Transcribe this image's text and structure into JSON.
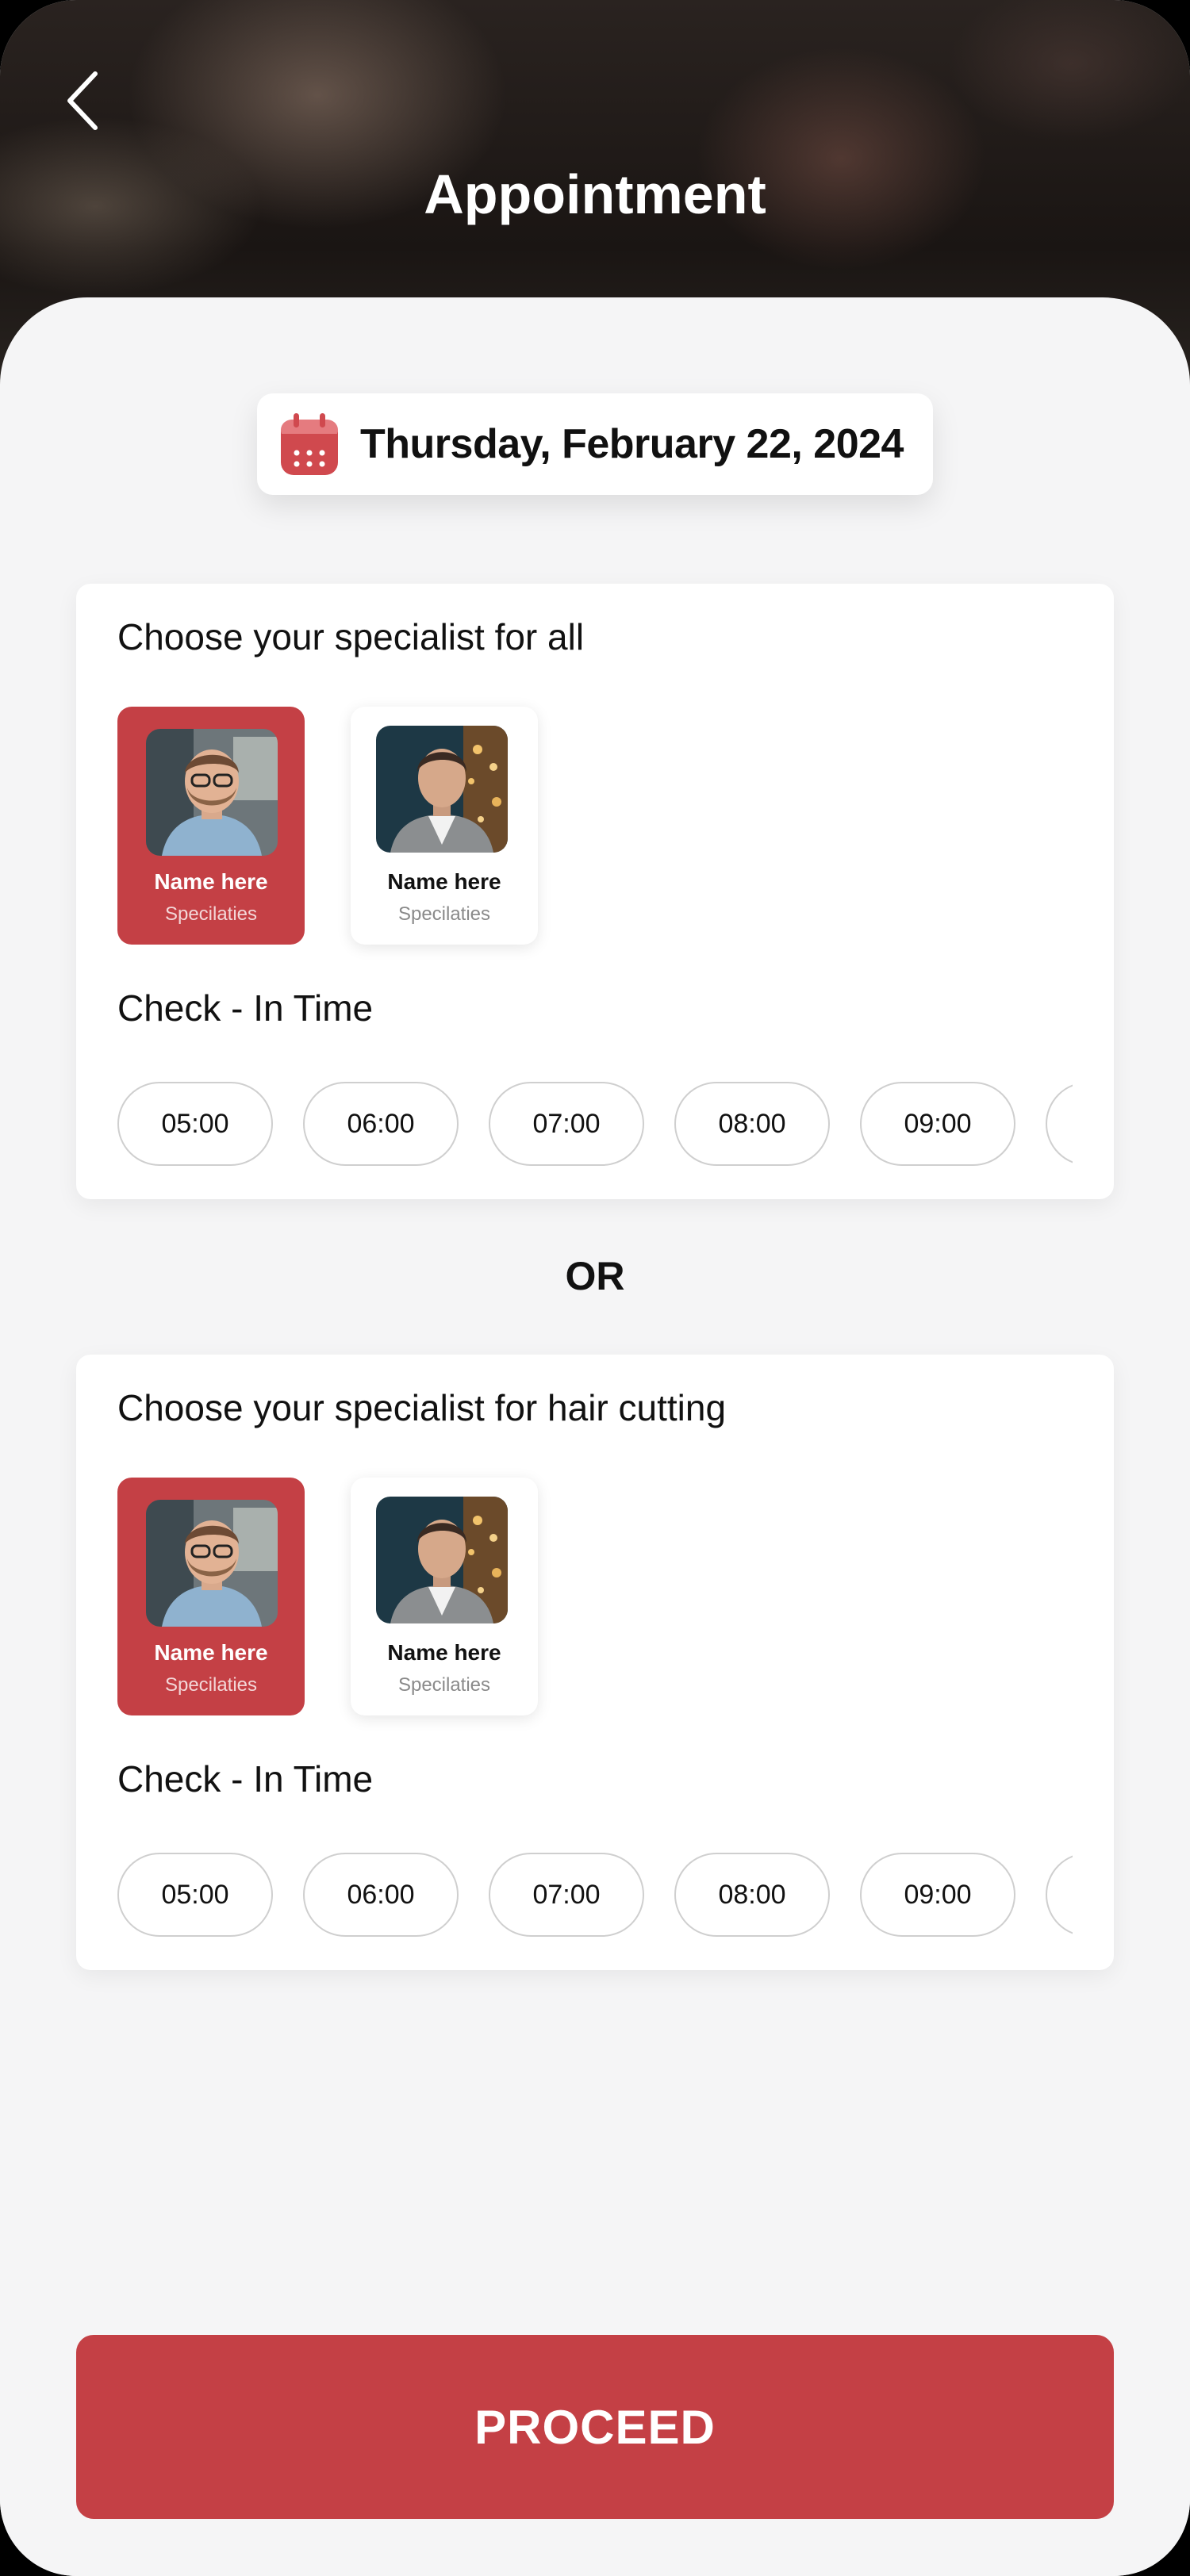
{
  "header": {
    "title": "Appointment",
    "back_icon": "chevron-left-icon"
  },
  "date_selector": {
    "icon": "calendar-icon",
    "accent": "#d0494e",
    "date_text": "Thursday, February 22, 2024"
  },
  "sections": [
    {
      "title": "Choose your specialist for all",
      "specialists": [
        {
          "name": "Name here",
          "subtitle": "Specilaties",
          "selected": true
        },
        {
          "name": "Name here",
          "subtitle": "Specilaties",
          "selected": false
        }
      ],
      "checkin_title": "Check - In Time",
      "times": [
        "05:00",
        "06:00",
        "07:00",
        "08:00",
        "09:00",
        ""
      ]
    },
    {
      "title": "Choose your specialist for hair cutting",
      "specialists": [
        {
          "name": "Name here",
          "subtitle": "Specilaties",
          "selected": true
        },
        {
          "name": "Name here",
          "subtitle": "Specilaties",
          "selected": false
        }
      ],
      "checkin_title": "Check - In Time",
      "times": [
        "05:00",
        "06:00",
        "07:00",
        "08:00",
        "09:00",
        ""
      ]
    }
  ],
  "or_label": "OR",
  "proceed_label": "PROCEED",
  "colors": {
    "primary": "#c44045",
    "background": "#f5f5f6",
    "text": "#111111"
  }
}
